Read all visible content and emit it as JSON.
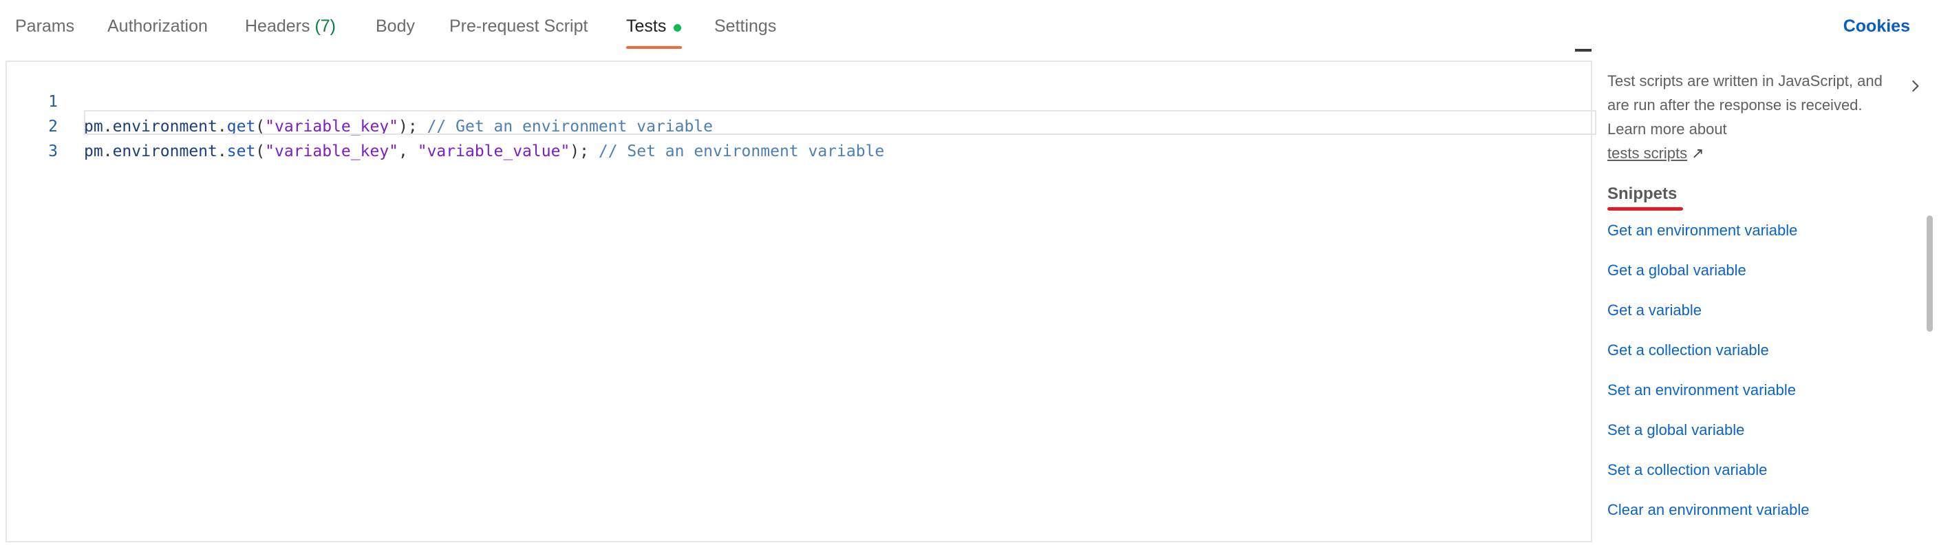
{
  "tabs": {
    "params": "Params",
    "authorization": "Authorization",
    "headers": "Headers",
    "headers_count": "(7)",
    "body": "Body",
    "prerequest": "Pre-request Script",
    "tests": "Tests",
    "settings": "Settings",
    "active": "Tests",
    "tests_indicator_color": "#0cbb52"
  },
  "cookies_label": "Cookies",
  "editor": {
    "lines": [
      {
        "number": "1",
        "tokens": [
          "pm",
          ".",
          "environment",
          ".",
          "get",
          "(",
          "\"variable_key\"",
          ");",
          " // Get an environment variable"
        ]
      },
      {
        "number": "2",
        "tokens": [
          "pm",
          ".",
          "environment",
          ".",
          "set",
          "(",
          "\"variable_key\"",
          ", ",
          "\"variable_value\"",
          ");",
          " // Set an environment variable"
        ]
      },
      {
        "number": "3",
        "tokens": []
      }
    ]
  },
  "side_panel": {
    "description": "Test scripts are written in JavaScript, and are run after the response is received. Learn more about",
    "link_text": "tests scripts",
    "link_icon": "external-link-arrow",
    "collapse_icon": "chevron-right-icon",
    "snippets_title": "Snippets",
    "snippets": [
      "Get an environment variable",
      "Get a global variable",
      "Get a variable",
      "Get a collection variable",
      "Set an environment variable",
      "Set a global variable",
      "Set a collection variable",
      "Clear an environment variable"
    ]
  },
  "colors": {
    "accent_tab_underline": "#f26b3a",
    "link_blue": "#0b63c9",
    "snippets_underline": "#e01b24"
  }
}
